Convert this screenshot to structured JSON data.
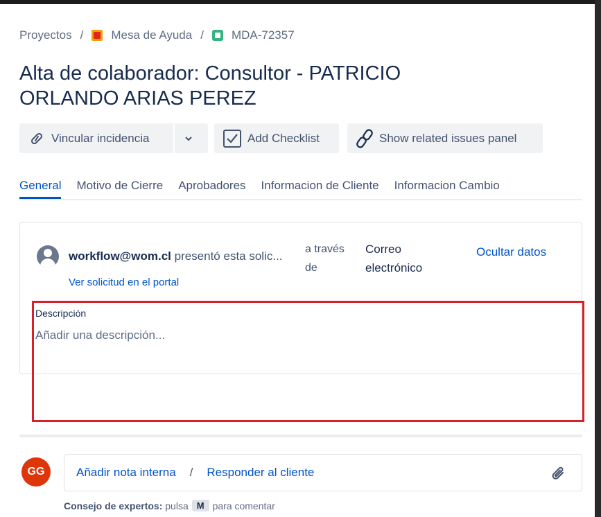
{
  "breadcrumb": {
    "projects": "Proyectos",
    "separator": "/",
    "project_name": "Mesa de Ayuda",
    "issue_key": "MDA-72357"
  },
  "title": "Alta de colaborador: Consultor - PATRICIO ORLANDO ARIAS PEREZ",
  "toolbar": {
    "link_issue": "Vincular incidencia",
    "add_checklist": "Add Checklist",
    "show_related": "Show related issues panel"
  },
  "tabs": [
    "General",
    "Motivo de Cierre",
    "Aprobadores",
    "Informacion de Cliente",
    "Informacion Cambio"
  ],
  "request": {
    "reporter": "workflow@wom.cl",
    "action": "presentó esta solic...",
    "via": "a través de",
    "channel": "Correo electrónico",
    "hide_data": "Ocultar datos",
    "portal_link": "Ver solicitud en el portal"
  },
  "description": {
    "label": "Descripción",
    "placeholder": "Añadir una descripción..."
  },
  "comment": {
    "avatar_initials": "GG",
    "internal_note": "Añadir nota interna",
    "separator": "/",
    "reply": "Responder al cliente"
  },
  "tip": {
    "prefix": "Consejo de expertos:",
    "press": "pulsa",
    "key": "M",
    "suffix": "para comentar"
  },
  "colors": {
    "accent": "#0052cc",
    "highlight": "#d4212b",
    "avatar": "#de350b"
  }
}
